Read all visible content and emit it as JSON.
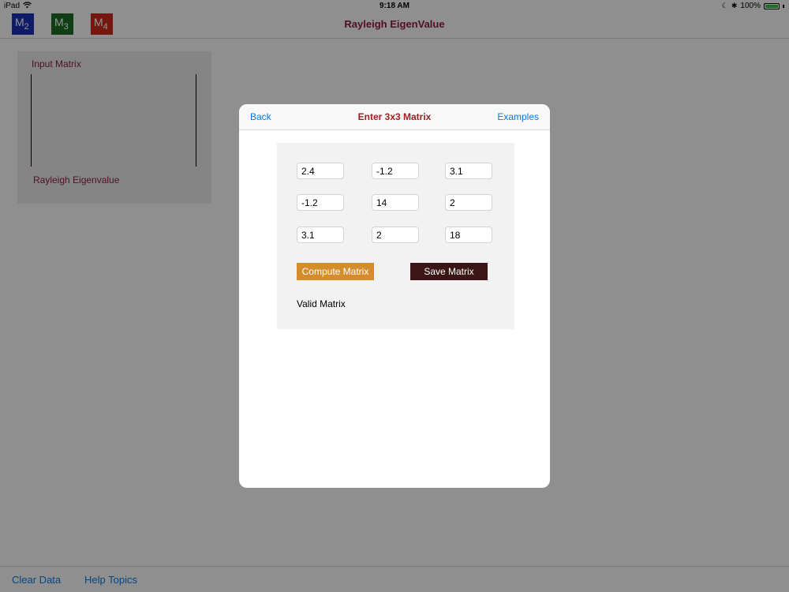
{
  "status_bar": {
    "device": "iPad",
    "time": "9:18 AM",
    "battery": "100%"
  },
  "nav": {
    "title": "Rayleigh EigenValue",
    "matrix_buttons": [
      {
        "label": "M",
        "sub": "2",
        "color": "#1d2fb3"
      },
      {
        "label": "M",
        "sub": "3",
        "color": "#1b6b24"
      },
      {
        "label": "M",
        "sub": "4",
        "color": "#c8281b"
      }
    ]
  },
  "input_panel": {
    "input_label": "Input Matrix",
    "eigen_label": "Rayleigh Eigenvalue"
  },
  "bottom_bar": {
    "clear_label": "Clear Data",
    "help_label": "Help Topics"
  },
  "modal": {
    "back_label": "Back",
    "title": "Enter 3x3 Matrix",
    "examples_label": "Examples",
    "matrix": [
      [
        "2.4",
        "-1.2",
        "3.1"
      ],
      [
        "-1.2",
        "14",
        "2"
      ],
      [
        "3.1",
        "2",
        "18"
      ]
    ],
    "compute_label": "Compute Matrix",
    "save_label": "Save Matrix",
    "status_text": "Valid Matrix"
  },
  "colors": {
    "accent_link": "#0a78e0",
    "title_maroon": "#8b1c3c",
    "compute_button": "#d58c2a",
    "save_button": "#3a1616"
  }
}
